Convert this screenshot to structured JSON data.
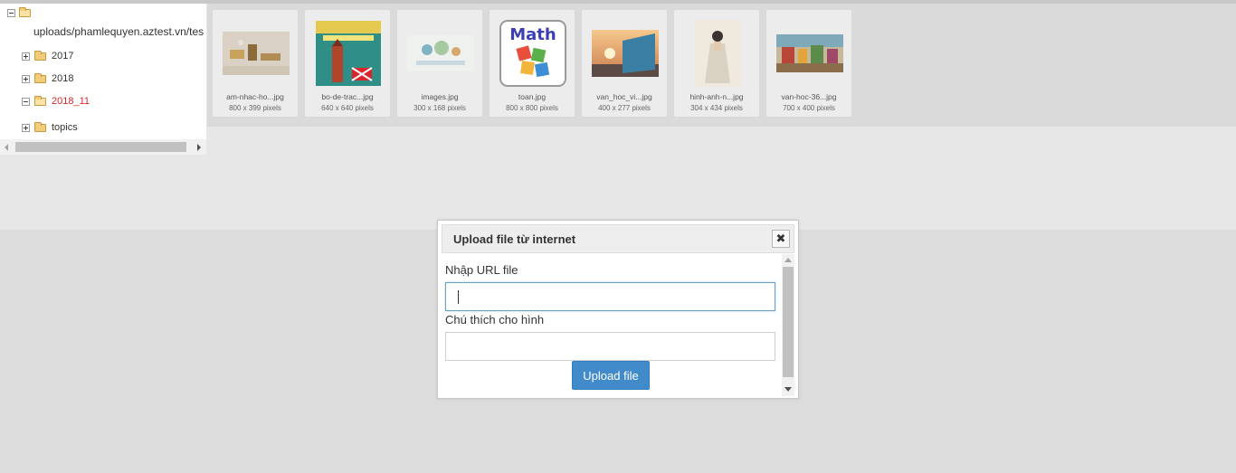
{
  "tree": {
    "root_path": "uploads/phamlequyen.aztest.vn/tes",
    "items": [
      {
        "label": "2017",
        "active": false
      },
      {
        "label": "2018",
        "active": false
      },
      {
        "label": "2018_11",
        "active": true
      },
      {
        "label": "topics",
        "active": false
      }
    ]
  },
  "thumbnails": [
    {
      "name": "am-nhac-ho...jpg",
      "size": "800 x 399 pixels",
      "icon": "music-image"
    },
    {
      "name": "bo-de-trac...jpg",
      "size": "640 x 640 pixels",
      "icon": "tieng-anh-book-cover"
    },
    {
      "name": "images.jpg",
      "size": "300 x 168 pixels",
      "icon": "english-banner-image"
    },
    {
      "name": "toan.jpg",
      "size": "800 x 800 pixels",
      "icon": "math-logo-image",
      "overlay_text": "Math"
    },
    {
      "name": "van_hoc_vi...jpg",
      "size": "400 x 277 pixels",
      "icon": "sunset-book-image"
    },
    {
      "name": "hinh-anh-n...jpg",
      "size": "304 x 434 pixels",
      "icon": "portrait-painting-image"
    },
    {
      "name": "van-hoc-36...jpg",
      "size": "700 x 400 pixels",
      "icon": "colorful-painting-image"
    }
  ],
  "dialog": {
    "title": "Upload file từ internet",
    "close_symbol": "✖",
    "url_label": "Nhập URL file",
    "url_value": "",
    "caption_label": "Chú thích cho hình",
    "caption_value": "",
    "upload_button": "Upload file"
  },
  "colors": {
    "accent": "#428bca",
    "active_folder": "#d9262b",
    "folder": "#f1cc79"
  }
}
